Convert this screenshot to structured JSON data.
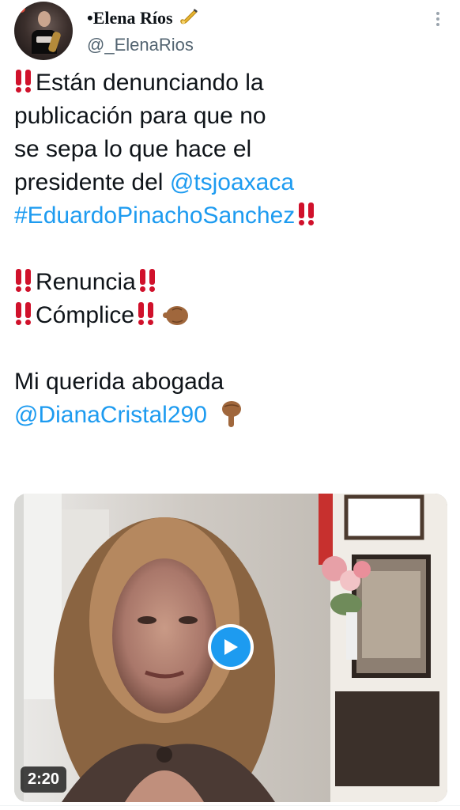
{
  "author": {
    "display_name": "•Elena Ríos",
    "handle": "@_ElenaRios",
    "avatar_icon": "user-avatar",
    "badge_icon": "saxophone-emoji"
  },
  "tweet": {
    "line1": "Están denunciando la",
    "line2": "publicación para que no",
    "line3": "se sepa lo que hace el",
    "line4_prefix": "presidente del ",
    "mention1": "@tsjoaxaca",
    "hashtag": "#EduardoPinachoSanchez",
    "renuncia": "Renuncia",
    "complice": "Cómplice",
    "line_querida": "Mi querida abogada",
    "mention2": "@DianaCristal290"
  },
  "media": {
    "duration": "2:20",
    "play_icon": "play-icon"
  },
  "colors": {
    "link": "#1d9bf0",
    "text": "#0f1419",
    "secondary": "#536471",
    "emoji_red": "#d0112b",
    "hand": "#a0673c"
  }
}
